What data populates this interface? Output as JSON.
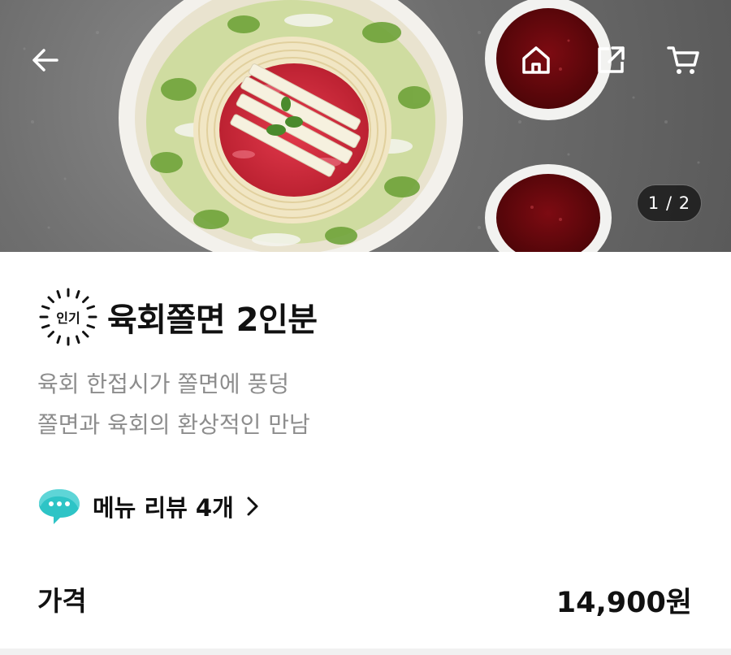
{
  "hero": {
    "image_description_icon": "food-photo",
    "counter": "1 / 2"
  },
  "toolbar": {
    "back_icon": "arrow-left-icon",
    "home_icon": "home-icon",
    "share_icon": "share-icon",
    "cart_icon": "cart-icon"
  },
  "product": {
    "badge": "인기",
    "title": "육회쫄면 2인분",
    "description": [
      "육회 한접시가 쫄면에 풍덩",
      "쫄면과 육회의 환상적인 만남"
    ]
  },
  "review": {
    "label": "메뉴 리뷰 4개"
  },
  "price": {
    "label": "가격",
    "value": "14,900원"
  },
  "colors": {
    "text": "#111111",
    "muted": "#8d8d8d",
    "bubble": "#2ec4c6",
    "counter_bg": "#141414"
  }
}
